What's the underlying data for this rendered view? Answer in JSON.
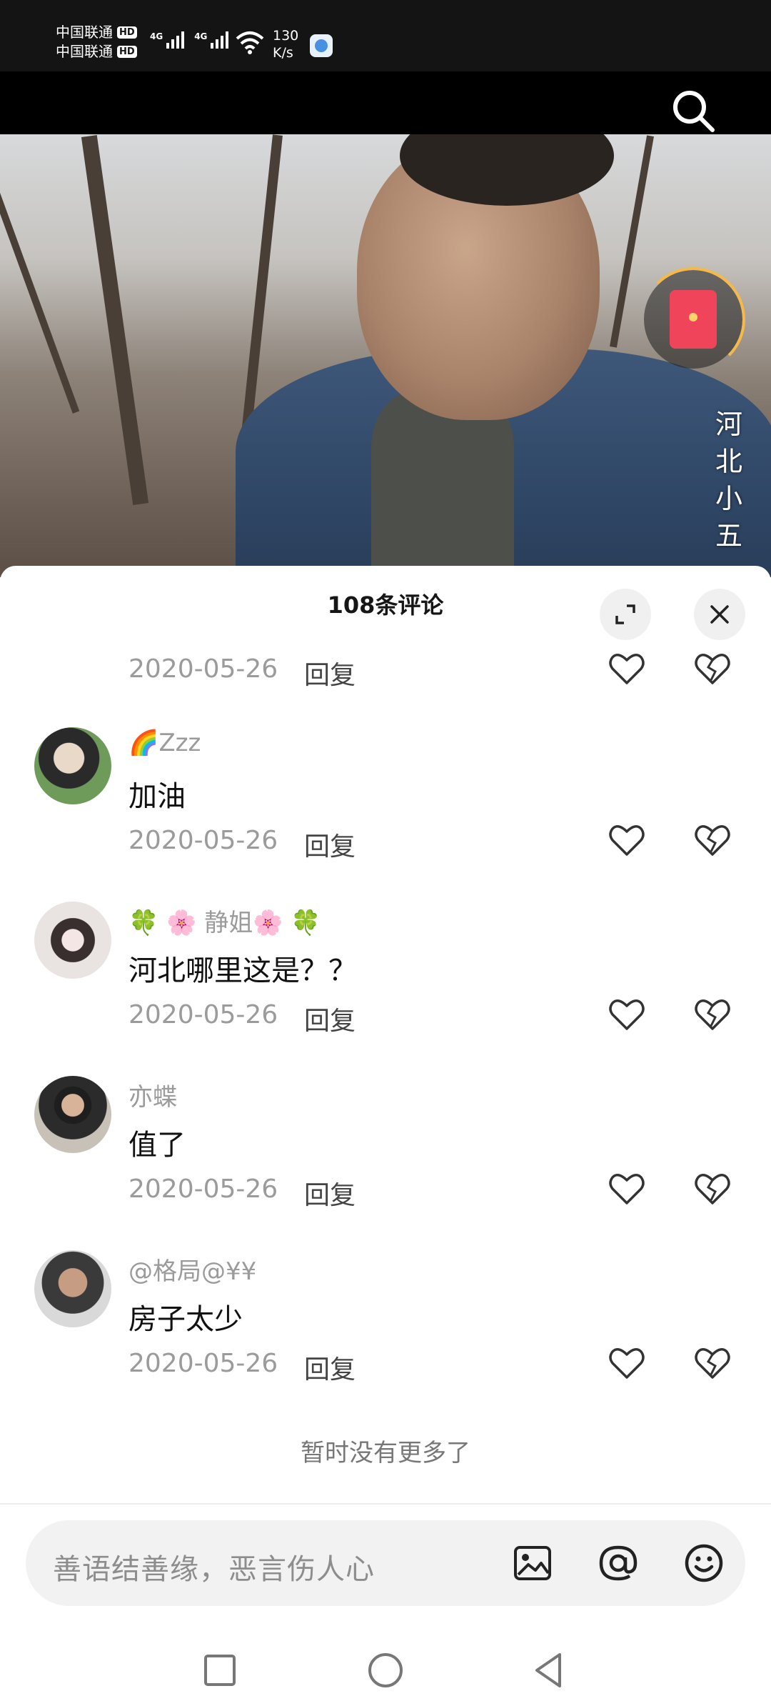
{
  "status_bar": {
    "carrier_1": "中国联通",
    "carrier_2": "中国联通",
    "hd_label": "HD",
    "network_label": "4G",
    "speed_value": "130",
    "speed_unit": "K/s"
  },
  "video": {
    "overlay_title": "河北小五"
  },
  "comments": {
    "title": "108条评论",
    "reply_label": "回复",
    "first_partial_date": "2020-05-26",
    "items": [
      {
        "user": "🌈Zzz",
        "text": "加油",
        "date": "2020-05-26"
      },
      {
        "user": "🍀 🌸 静姐🌸 🍀",
        "text": "河北哪里这是？？",
        "date": "2020-05-26"
      },
      {
        "user": "亦蝶",
        "text": "值了",
        "date": "2020-05-26"
      },
      {
        "user": "@格局@¥¥",
        "text": "房子太少",
        "date": "2020-05-26"
      }
    ],
    "no_more": "暂时没有更多了"
  },
  "input": {
    "placeholder": "善语结善缘，恶言伤人心"
  },
  "colors": {
    "accent_red": "#f0445a",
    "ring_gold": "#f5b94a",
    "muted_text": "#9b9b9b"
  }
}
